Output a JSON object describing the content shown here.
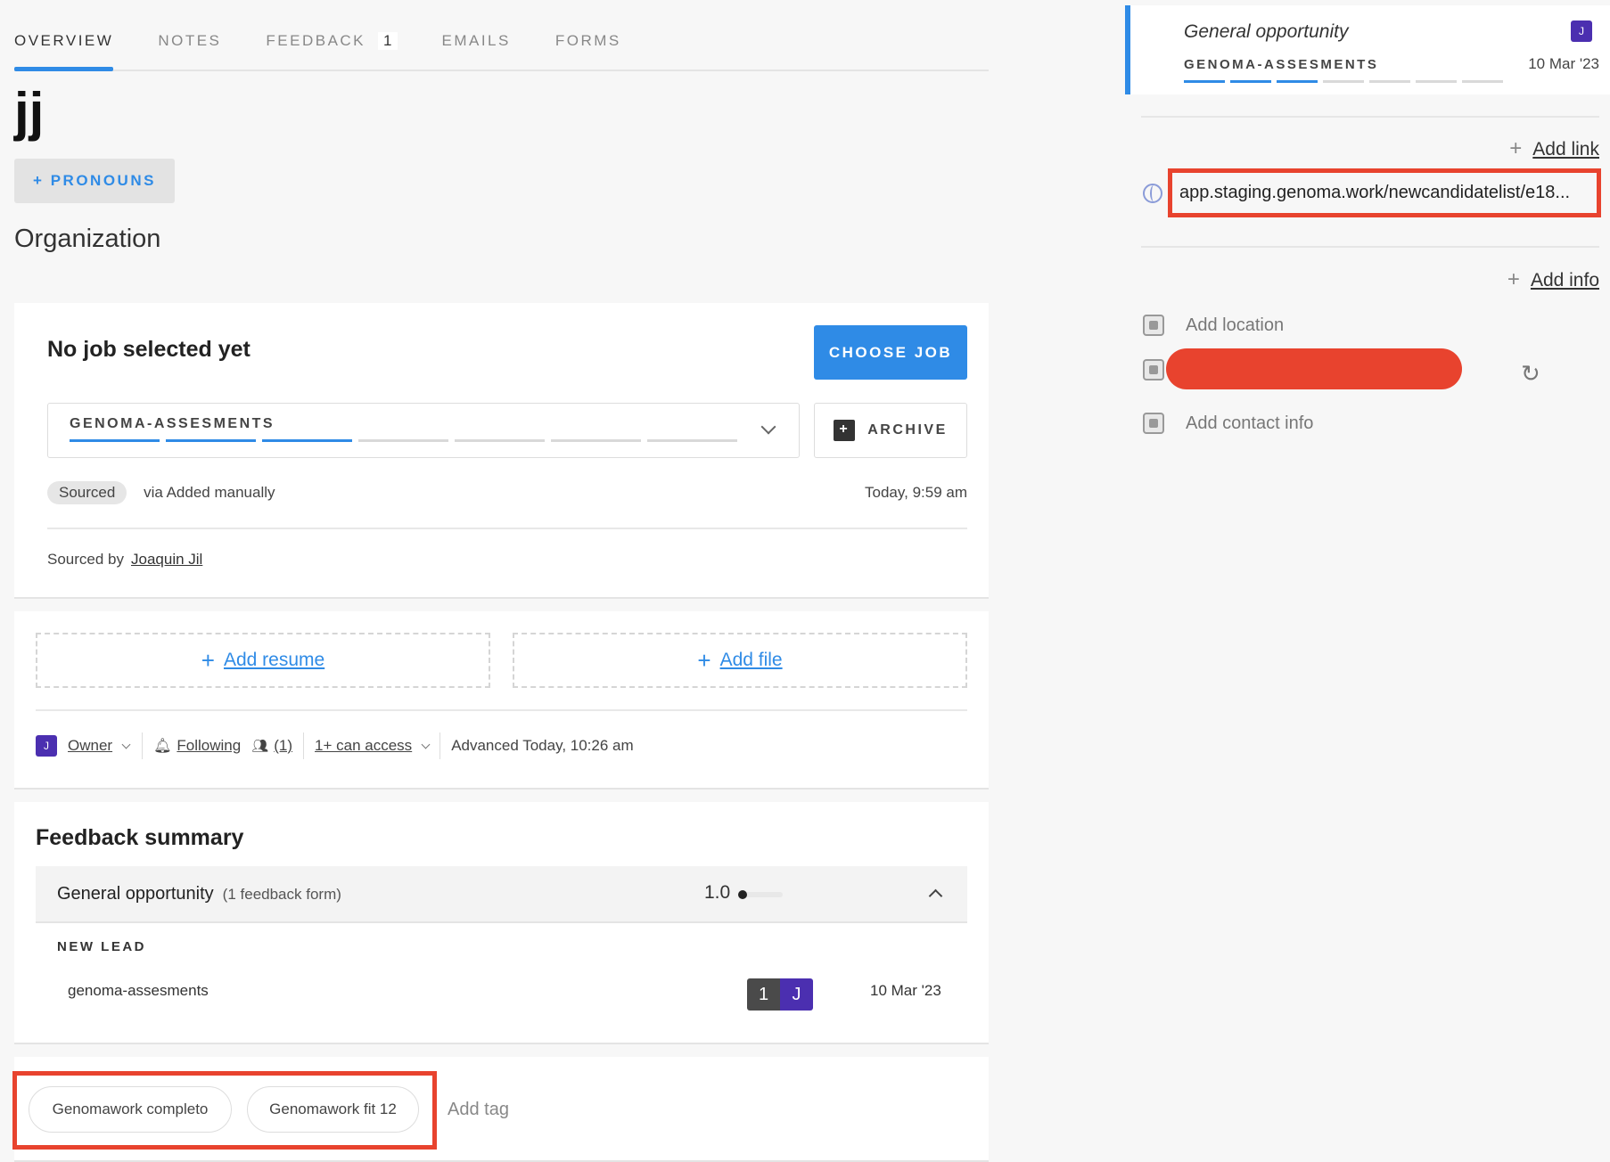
{
  "tabs": [
    {
      "label": "OVERVIEW",
      "active": true
    },
    {
      "label": "NOTES"
    },
    {
      "label": "FEEDBACK",
      "badge": "1"
    },
    {
      "label": "EMAILS"
    },
    {
      "label": "FORMS"
    }
  ],
  "candidate": {
    "name": "jj",
    "pronouns_label": "+ PRONOUNS",
    "organization_label": "Organization"
  },
  "job": {
    "title": "No job selected yet",
    "choose_button": "CHOOSE JOB",
    "pipeline_name": "GENOMA-ASSESMENTS",
    "stages_completed": 3,
    "stages_total": 7,
    "archive_button": "ARCHIVE",
    "source_badge": "Sourced",
    "source_via": "via Added manually",
    "source_time": "Today, 9:59 am",
    "sourced_by_label": "Sourced by",
    "sourced_by_name": "Joaquin Jil"
  },
  "files": {
    "add_resume": "Add resume",
    "add_file": "Add file",
    "plus_glyph": "+"
  },
  "meta": {
    "owner_avatar": "J",
    "owner_label": "Owner",
    "following_label": "Following",
    "followers_count": "(1)",
    "access_label": "1+ can access",
    "advanced_label": "Advanced Today, 10:26 am"
  },
  "feedback": {
    "title": "Feedback summary",
    "opportunity_name": "General opportunity",
    "forms_count": "(1 feedback form)",
    "score": "1.0",
    "stage": "NEW LEAD",
    "row_name": "genoma-assesments",
    "count": "1",
    "avatar": "J",
    "date": "10 Mar '23"
  },
  "tags": {
    "items": [
      "Genomawork completo",
      "Genomawork fit 12"
    ],
    "add_tag": "Add tag"
  },
  "opportunity": {
    "title": "General opportunity",
    "avatar": "J",
    "pipeline": "GENOMA-ASSESMENTS",
    "date": "10 Mar '23",
    "stages_completed": 3,
    "stages_total": 7
  },
  "links": {
    "add_link": "Add link",
    "url": "app.staging.genoma.work/newcandidatelist/e18..."
  },
  "info": {
    "add_info": "Add info",
    "add_location": "Add location",
    "add_contact": "Add contact info"
  },
  "colors": {
    "accent": "#2f8be6",
    "avatar": "#4b2fb0",
    "highlight": "#e8432e"
  }
}
